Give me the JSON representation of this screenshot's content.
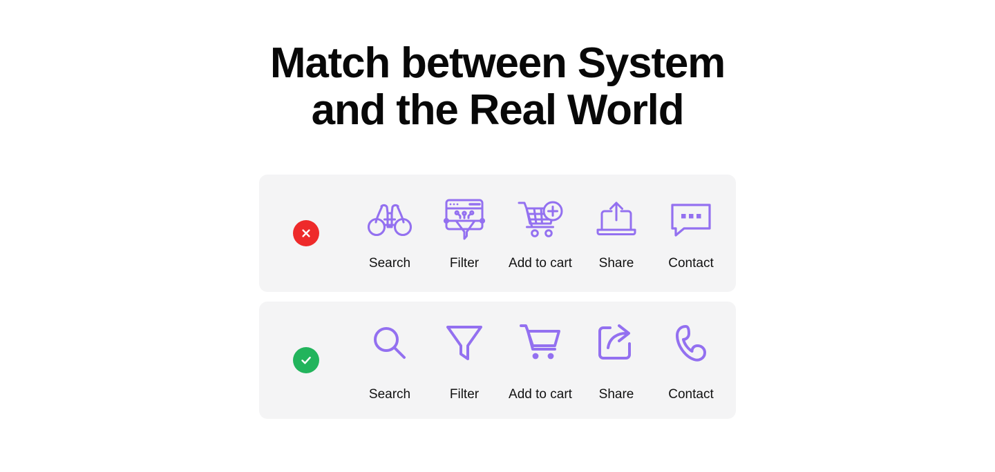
{
  "page": {
    "background_color": "#ffffff",
    "accent_color": "#9370f0",
    "card_background": "#f4f4f5",
    "text_color": "#111111"
  },
  "heading": {
    "line1": "Match between System",
    "line2": "and the Real World"
  },
  "rows": [
    {
      "id": "bad-example",
      "badge": {
        "name": "error-badge",
        "symbol": "cross",
        "color": "#ee2a2a"
      },
      "items": [
        {
          "label": "Search",
          "icon": "binoculars-icon"
        },
        {
          "label": "Filter",
          "icon": "browser-circuit-funnel-icon"
        },
        {
          "label": "Add to cart",
          "icon": "cart-plus-grid-icon"
        },
        {
          "label": "Share",
          "icon": "laptop-upload-icon"
        },
        {
          "label": "Contact",
          "icon": "speech-bubble-dots-icon"
        }
      ]
    },
    {
      "id": "good-example",
      "badge": {
        "name": "success-badge",
        "symbol": "check",
        "color": "#22b45c"
      },
      "items": [
        {
          "label": "Search",
          "icon": "magnifier-icon"
        },
        {
          "label": "Filter",
          "icon": "funnel-icon"
        },
        {
          "label": "Add to cart",
          "icon": "shopping-cart-icon"
        },
        {
          "label": "Share",
          "icon": "share-box-arrow-icon"
        },
        {
          "label": "Contact",
          "icon": "phone-handset-icon"
        }
      ]
    }
  ]
}
